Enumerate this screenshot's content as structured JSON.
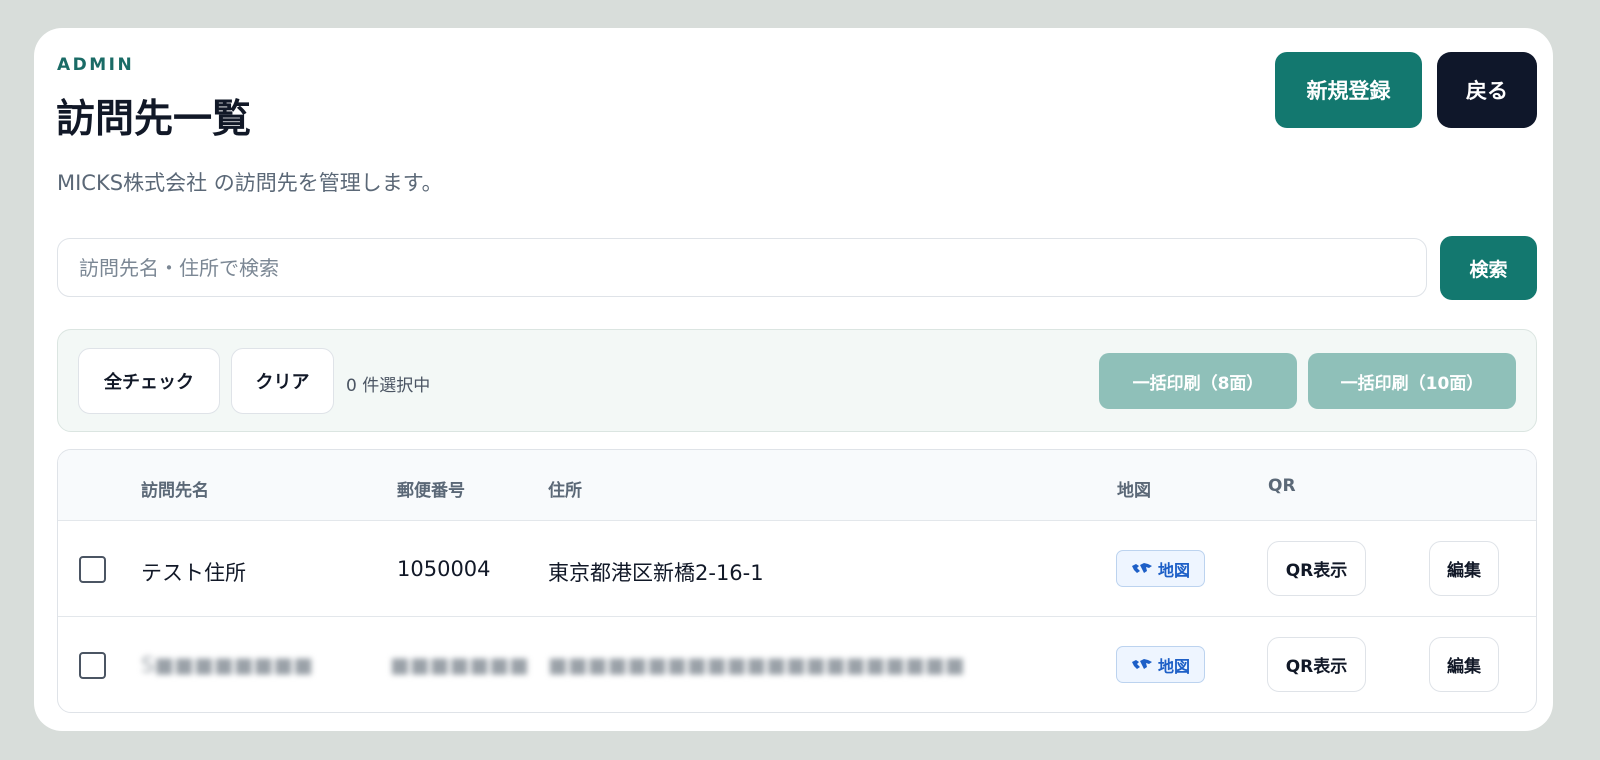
{
  "header": {
    "eyebrow": "ADMIN",
    "title": "訪問先一覧",
    "subtitle": "MICKS株式会社 の訪問先を管理します。",
    "new_button": "新規登録",
    "back_button": "戻る"
  },
  "search": {
    "placeholder": "訪問先名・住所で検索",
    "value": "",
    "button": "検索"
  },
  "toolbar": {
    "check_all": "全チェック",
    "clear": "クリア",
    "selected_count": "0 件選択中",
    "print_8": "一括印刷（8面）",
    "print_10": "一括印刷（10面）"
  },
  "table": {
    "columns": [
      "訪問先名",
      "郵便番号",
      "住所",
      "地図",
      "QR"
    ],
    "rows": [
      {
        "name": "テスト住所",
        "postal": "1050004",
        "address": "東京都港区新橋2-16-1",
        "map_label": "地図",
        "qr_label": "QR表示",
        "edit_label": "編集",
        "checked": false
      },
      {
        "name": "S■■■■■■■■",
        "postal": "■■■■■■■",
        "address": "■■■■■■■■■■■■■■■■■■■■■",
        "map_label": "地図",
        "qr_label": "QR表示",
        "edit_label": "編集",
        "checked": false
      }
    ]
  },
  "icons": {
    "map": "map-icon"
  },
  "colors": {
    "primary": "#13786f",
    "dark": "#0f172a",
    "disabled": "#8fc0b9",
    "map_badge": "#1d5fc7"
  }
}
